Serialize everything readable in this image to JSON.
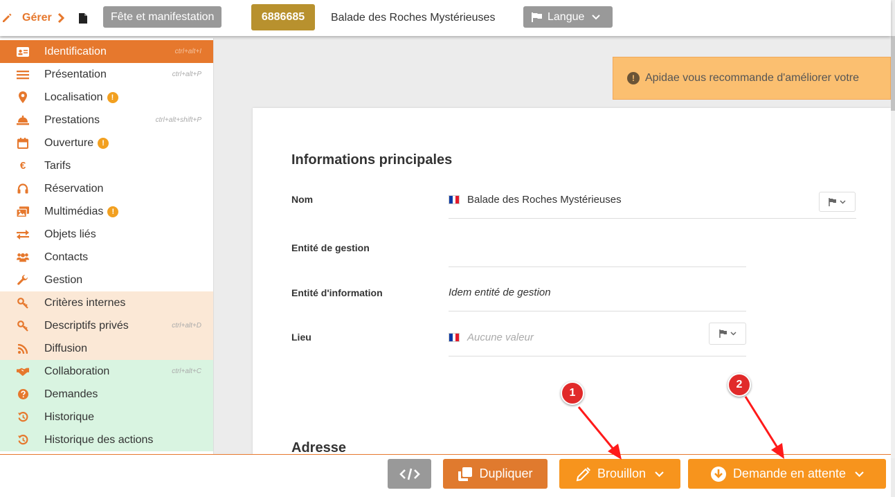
{
  "topbar": {
    "manage_label": "Gérer",
    "type_label": "Fête et manifestation",
    "object_id": "6886685",
    "object_title": "Balade des Roches Mystérieuses",
    "language_label": "Langue"
  },
  "sidebar": {
    "items": [
      {
        "label": "Identification",
        "shortcut": "ctrl+alt+I"
      },
      {
        "label": "Présentation",
        "shortcut": "ctrl+alt+P"
      },
      {
        "label": "Localisation",
        "shortcut": ""
      },
      {
        "label": "Prestations",
        "shortcut": "ctrl+alt+shift+P"
      },
      {
        "label": "Ouverture",
        "shortcut": ""
      },
      {
        "label": "Tarifs",
        "shortcut": ""
      },
      {
        "label": "Réservation",
        "shortcut": ""
      },
      {
        "label": "Multimédias",
        "shortcut": ""
      },
      {
        "label": "Objets liés",
        "shortcut": ""
      },
      {
        "label": "Contacts",
        "shortcut": ""
      },
      {
        "label": "Gestion",
        "shortcut": ""
      },
      {
        "label": "Critères internes",
        "shortcut": ""
      },
      {
        "label": "Descriptifs privés",
        "shortcut": "ctrl+alt+D"
      },
      {
        "label": "Diffusion",
        "shortcut": ""
      },
      {
        "label": "Collaboration",
        "shortcut": "ctrl+alt+C"
      },
      {
        "label": "Demandes",
        "shortcut": ""
      },
      {
        "label": "Historique",
        "shortcut": ""
      },
      {
        "label": "Historique des actions",
        "shortcut": ""
      }
    ]
  },
  "alert": {
    "text": "Apidae vous recommande d'améliorer votre"
  },
  "main": {
    "section_title": "Informations principales",
    "fields": {
      "nom": {
        "label": "Nom",
        "value": "Balade des Roches Mystérieuses"
      },
      "entite_gestion": {
        "label": "Entité de gestion",
        "value": ""
      },
      "entite_information": {
        "label": "Entité d'information",
        "value": "Idem entité de gestion"
      },
      "lieu": {
        "label": "Lieu",
        "placeholder": "Aucune valeur"
      }
    },
    "next_section_title": "Adresse"
  },
  "bottombar": {
    "duplicate_label": "Dupliquer",
    "draft_label": "Brouillon",
    "pending_label": "Demande en attente"
  },
  "annotations": {
    "marker1": "1",
    "marker2": "2"
  },
  "colors": {
    "brand_orange": "#e6782d",
    "button_orange": "#f7941d",
    "id_badge": "#b8912e",
    "alert_bg": "#fbbf70",
    "active_bg": "#e6782d",
    "peach_group": "#fbe8d6",
    "green_group": "#d9f4e1",
    "annotation_red": "#e12a2a"
  },
  "icons": {
    "manage": "pencil-icon",
    "document": "document-icon",
    "language": "flag-icon",
    "code": "code-icon",
    "duplicate": "copy-icon",
    "draft": "pencil-icon",
    "pending": "download-circle-icon"
  }
}
